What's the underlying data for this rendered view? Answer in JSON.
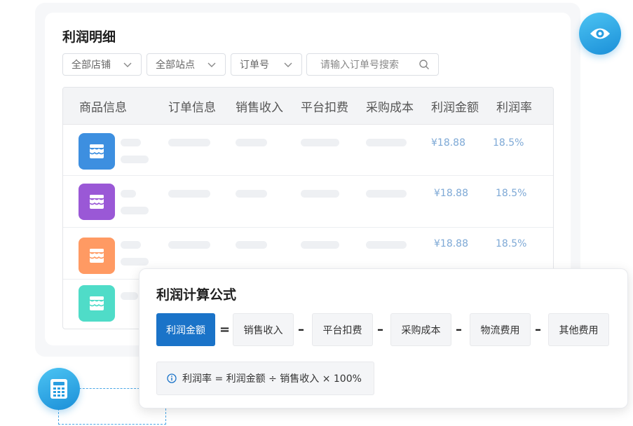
{
  "page": {
    "title": "利润明细"
  },
  "filters": {
    "store": "全部店铺",
    "site": "全部站点",
    "order_no": "订单号",
    "search_placeholder": "请输入订单号搜索"
  },
  "table": {
    "columns": [
      "商品信息",
      "订单信息",
      "销售收入",
      "平台扣费",
      "采购成本",
      "利润金额",
      "利润率"
    ],
    "rows": [
      {
        "icon_color": "#3d8fe0",
        "profit": "¥18.88",
        "rate": "18.5%"
      },
      {
        "icon_color": "#9a58d6",
        "profit": "¥18.88",
        "rate": "18.5%"
      },
      {
        "icon_color": "#ff9a63",
        "profit": "¥18.88",
        "rate": "18.5%"
      },
      {
        "icon_color": "#4fdcc8"
      }
    ]
  },
  "formula": {
    "title": "利润计算公式",
    "result": "利润金额",
    "equals": "=",
    "minus": "–",
    "terms": [
      "销售收入",
      "平台扣费",
      "采购成本",
      "物流费用",
      "其他费用"
    ],
    "note": "利润率 = 利润金额 ÷ 销售收入 × 100%"
  },
  "icons": {
    "view": "eye-icon",
    "calculator": "calculator-icon",
    "shop": "store-icon",
    "info": "info-icon",
    "search": "search-icon",
    "dropdown": "chevron-down-icon"
  },
  "colors": {
    "accent": "#1a73c8",
    "value_text": "#7ea9d6",
    "connector": "#4aa6e6"
  }
}
